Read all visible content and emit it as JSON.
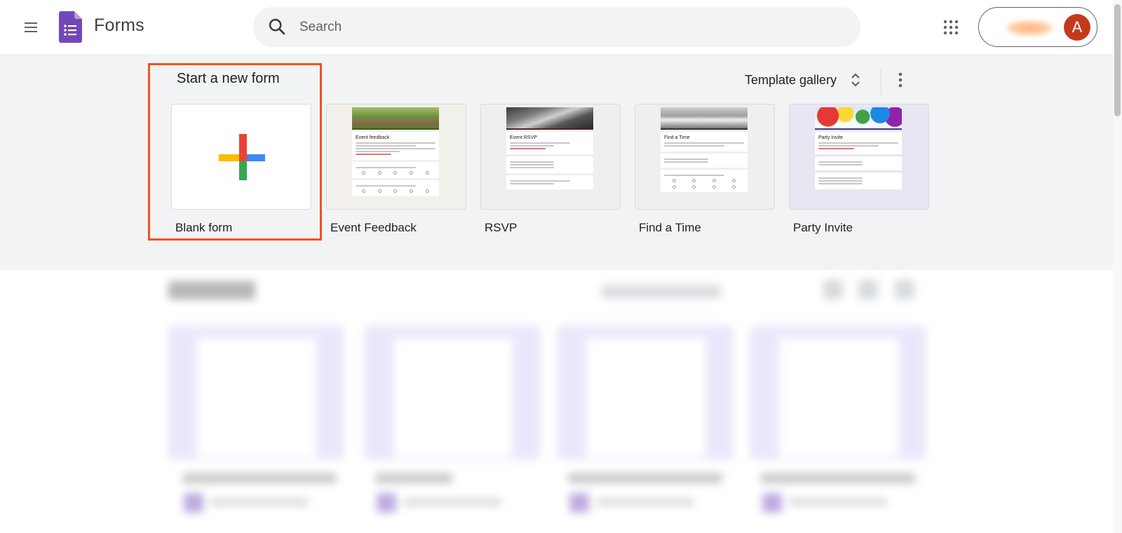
{
  "header": {
    "app_name": "Forms",
    "search_placeholder": "Search",
    "avatar_initial": "A"
  },
  "templates": {
    "section_title": "Start a new form",
    "gallery_label": "Template gallery",
    "items": [
      {
        "label": "Blank form",
        "thumb_title": ""
      },
      {
        "label": "Event Feedback",
        "thumb_title": "Event feedback"
      },
      {
        "label": "RSVP",
        "thumb_title": "Event RSVP"
      },
      {
        "label": "Find a Time",
        "thumb_title": "Find a Time"
      },
      {
        "label": "Party Invite",
        "thumb_title": "Party Invite"
      }
    ]
  },
  "colors": {
    "highlight": "#f4511e",
    "forms_purple": "#7248b9",
    "avatar_bg": "#c5391b",
    "band_bg": "#f1f3f4"
  }
}
